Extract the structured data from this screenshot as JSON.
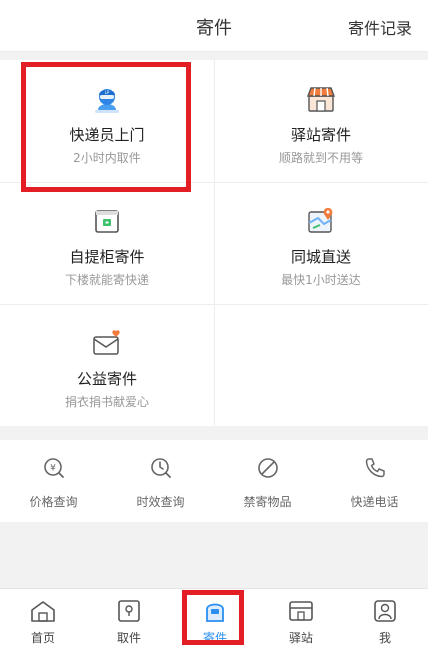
{
  "header": {
    "title": "寄件",
    "record_link": "寄件记录"
  },
  "services": [
    {
      "title": "快递员上门",
      "subtitle": "2小时内取件",
      "icon": "courier-icon"
    },
    {
      "title": "驿站寄件",
      "subtitle": "顺路就到不用等",
      "icon": "station-icon"
    },
    {
      "title": "自提柜寄件",
      "subtitle": "下楼就能寄快递",
      "icon": "locker-icon"
    },
    {
      "title": "同城直送",
      "subtitle": "最快1小时送达",
      "icon": "map-pin-icon"
    },
    {
      "title": "公益寄件",
      "subtitle": "捐衣捐书献爱心",
      "icon": "charity-envelope-icon"
    }
  ],
  "tools": [
    {
      "label": "价格查询",
      "icon": "price-icon"
    },
    {
      "label": "时效查询",
      "icon": "clock-icon"
    },
    {
      "label": "禁寄物品",
      "icon": "prohibited-icon"
    },
    {
      "label": "快递电话",
      "icon": "phone-icon"
    }
  ],
  "tabbar": [
    {
      "label": "首页",
      "icon": "home-icon",
      "active": false
    },
    {
      "label": "取件",
      "icon": "pickup-icon",
      "active": false
    },
    {
      "label": "寄件",
      "icon": "send-icon",
      "active": true
    },
    {
      "label": "驿站",
      "icon": "station-tab-icon",
      "active": false
    },
    {
      "label": "我",
      "icon": "me-icon",
      "active": false
    }
  ],
  "colors": {
    "accent_blue": "#2a8ff0",
    "highlight_red": "#e31e24",
    "brand_orange": "#f07b3a"
  }
}
